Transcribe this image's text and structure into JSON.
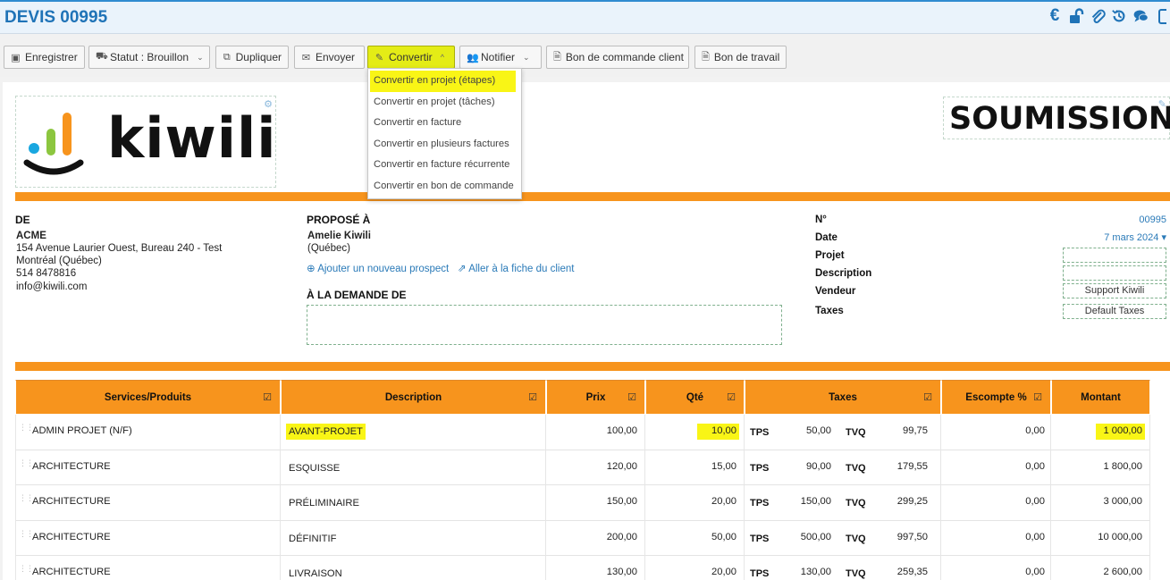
{
  "header": {
    "title": "DEVIS 00995",
    "icons": [
      "euro-icon",
      "unlock-icon",
      "paperclip-icon",
      "history-icon",
      "comments-icon",
      "share-icon"
    ]
  },
  "toolbar": {
    "save": "Enregistrer",
    "status": "Statut : Brouillon",
    "duplicate": "Dupliquer",
    "send": "Envoyer",
    "convert": "Convertir",
    "notify": "Notifier",
    "purchase_order": "Bon de commande client",
    "work_order": "Bon de travail"
  },
  "convert_menu": [
    "Convertir en projet (étapes)",
    "Convertir en projet (tâches)",
    "Convertir en facture",
    "Convertir en plusieurs factures",
    "Convertir en facture récurrente",
    "Convertir en bon de commande"
  ],
  "document": {
    "logo_text": "kiwili",
    "doc_type": "SOUMISSION",
    "colors": {
      "accent_orange": "#f7941d",
      "highlight_yellow": "#f9f516",
      "link_blue": "#2a7ab8"
    },
    "from": {
      "heading": "DE",
      "company": "ACME",
      "address1": "154 Avenue Laurier Ouest, Bureau 240 - Test",
      "address2": "Montréal (Québec)",
      "phone": "514 8478816",
      "email": "info@kiwili.com"
    },
    "to": {
      "heading": "PROPOSÉ À",
      "name": "Amelie Kiwili",
      "region": "(Québec)",
      "add_prospect": "Ajouter un nouveau prospect",
      "client_file": "Aller à la fiche du client",
      "request_heading": "À LA DEMANDE DE"
    },
    "meta": {
      "number_label": "N°",
      "number_value": "00995",
      "date_label": "Date",
      "date_value": "7 mars 2024",
      "project_label": "Projet",
      "description_label": "Description",
      "seller_label": "Vendeur",
      "seller_value": "Support Kiwili",
      "taxes_label": "Taxes",
      "taxes_value": "Default Taxes"
    }
  },
  "table": {
    "headers": {
      "product": "Services/Produits",
      "description": "Description",
      "price": "Prix",
      "qty": "Qté",
      "taxes": "Taxes",
      "discount": "Escompte %",
      "amount": "Montant"
    },
    "tax1_label": "TPS",
    "tax2_label": "TVQ",
    "rows": [
      {
        "product": "ADMIN PROJET (N/F)",
        "description": "AVANT-PROJET",
        "price": "100,00",
        "qty": "10,00",
        "tps": "50,00",
        "tvq": "99,75",
        "discount": "0,00",
        "amount": "1 000,00"
      },
      {
        "product": "ARCHITECTURE",
        "description": "ESQUISSE",
        "price": "120,00",
        "qty": "15,00",
        "tps": "90,00",
        "tvq": "179,55",
        "discount": "0,00",
        "amount": "1 800,00"
      },
      {
        "product": "ARCHITECTURE",
        "description": "PRÉLIMINAIRE",
        "price": "150,00",
        "qty": "20,00",
        "tps": "150,00",
        "tvq": "299,25",
        "discount": "0,00",
        "amount": "3 000,00"
      },
      {
        "product": "ARCHITECTURE",
        "description": "DÉFINITIF",
        "price": "200,00",
        "qty": "50,00",
        "tps": "500,00",
        "tvq": "997,50",
        "discount": "0,00",
        "amount": "10 000,00"
      },
      {
        "product": "ARCHITECTURE",
        "description": "LIVRAISON",
        "price": "130,00",
        "qty": "20,00",
        "tps": "130,00",
        "tvq": "259,35",
        "discount": "0,00",
        "amount": "2 600,00"
      }
    ]
  }
}
